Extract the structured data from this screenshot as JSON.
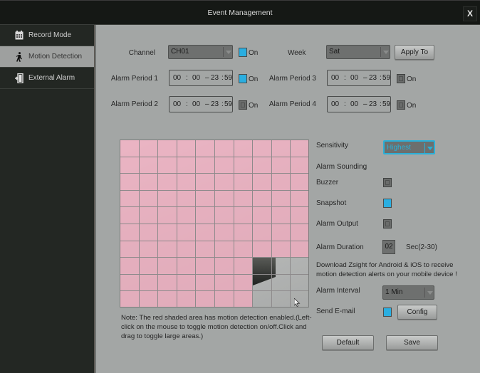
{
  "window": {
    "title": "Event Management",
    "close_label": "X"
  },
  "sidebar": {
    "items": [
      {
        "label": "Record Mode",
        "icon": "calendar-icon",
        "active": false
      },
      {
        "label": "Motion Detection",
        "icon": "walking-person-icon",
        "active": true
      },
      {
        "label": "External Alarm",
        "icon": "door-exit-icon",
        "active": false
      }
    ]
  },
  "form": {
    "channel": {
      "label": "Channel",
      "value": "CH01",
      "enabled": true,
      "on_label": "On"
    },
    "week": {
      "label": "Week",
      "value": "Sat"
    },
    "apply_to_label": "Apply To",
    "periods": [
      {
        "label": "Alarm Period 1",
        "start_h": "00",
        "start_m": "00",
        "end_h": "23",
        "end_m": "59",
        "enabled": true,
        "on_label": "On"
      },
      {
        "label": "Alarm Period 2",
        "start_h": "00",
        "start_m": "00",
        "end_h": "23",
        "end_m": "59",
        "enabled": false,
        "on_label": "On"
      },
      {
        "label": "Alarm Period 3",
        "start_h": "00",
        "start_m": "00",
        "end_h": "23",
        "end_m": "59",
        "enabled": false,
        "on_label": "On"
      },
      {
        "label": "Alarm Period 4",
        "start_h": "00",
        "start_m": "00",
        "end_h": "23",
        "end_m": "59",
        "enabled": false,
        "on_label": "On"
      }
    ],
    "time_sep": ":",
    "range_sep": "–"
  },
  "motion_grid": {
    "rows": 10,
    "cols": 10,
    "disabled_cells": "rows 7-9, cols 7-9 (0-indexed)",
    "enabled_color": "#f0aabe",
    "note": "Note: The red shaded area has motion detection enabled.(Left-click on the mouse to toggle motion detection on/off.Click and drag to toggle large areas.)"
  },
  "settings": {
    "sensitivity": {
      "label": "Sensitivity",
      "value": "Highest"
    },
    "alarm_sounding_label": "Alarm Sounding",
    "buzzer": {
      "label": "Buzzer",
      "checked": false
    },
    "snapshot": {
      "label": "Snapshot",
      "checked": true
    },
    "alarm_output": {
      "label": "Alarm Output",
      "checked": false
    },
    "alarm_duration": {
      "label": "Alarm Duration",
      "value": "02",
      "unit": "Sec(2-30)"
    },
    "download_text": "Download Zsight for Android & iOS to receive motion detection alerts on your mobile device !",
    "alarm_interval": {
      "label": "Alarm Interval",
      "value": "1 Min"
    },
    "send_email": {
      "label": "Send E-mail",
      "checked": true,
      "config_label": "Config"
    }
  },
  "footer": {
    "default_label": "Default",
    "save_label": "Save"
  },
  "colors": {
    "accent": "#2aaee0",
    "panel": "#a3a6a5",
    "sidebar": "#232723",
    "titlebar": "#151815"
  }
}
